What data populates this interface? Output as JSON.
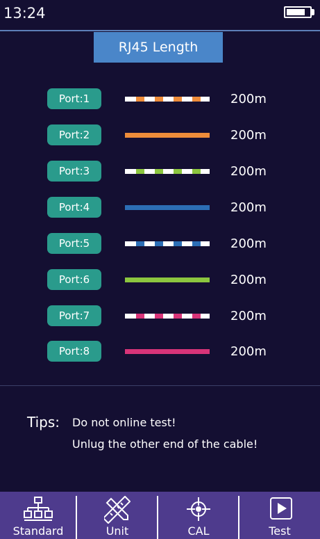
{
  "status": {
    "time": "13:24",
    "battery_level": 0.8
  },
  "title": "RJ45 Length",
  "colors": {
    "background": "#140f32",
    "title_bg": "#4a86c9",
    "badge_bg": "#2a9b8c",
    "toolbar_bg": "#4e3b8d"
  },
  "ports": [
    {
      "label": "Port:1",
      "length": "200m",
      "wire": "white-orange",
      "color": "#ee8c3a",
      "striped": true
    },
    {
      "label": "Port:2",
      "length": "200m",
      "wire": "orange",
      "color": "#ee8c3a",
      "striped": false
    },
    {
      "label": "Port:3",
      "length": "200m",
      "wire": "white-green",
      "color": "#8cc63f",
      "striped": true
    },
    {
      "label": "Port:4",
      "length": "200m",
      "wire": "blue",
      "color": "#2c6eb5",
      "striped": false
    },
    {
      "label": "Port:5",
      "length": "200m",
      "wire": "white-blue",
      "color": "#2c6eb5",
      "striped": true
    },
    {
      "label": "Port:6",
      "length": "200m",
      "wire": "green",
      "color": "#8cc63f",
      "striped": false
    },
    {
      "label": "Port:7",
      "length": "200m",
      "wire": "white-brown",
      "color": "#d83479",
      "striped": true
    },
    {
      "label": "Port:8",
      "length": "200m",
      "wire": "brown",
      "color": "#d83479",
      "striped": false
    }
  ],
  "tips": {
    "label": "Tips:",
    "lines": [
      "Do not online test!",
      "Unlug the other end of the cable!"
    ]
  },
  "toolbar": [
    {
      "label": "Standard",
      "icon": "network-topology-icon"
    },
    {
      "label": "Unit",
      "icon": "ruler-pencil-icon"
    },
    {
      "label": "CAL",
      "icon": "crosshair-icon"
    },
    {
      "label": "Test",
      "icon": "play-icon"
    }
  ]
}
